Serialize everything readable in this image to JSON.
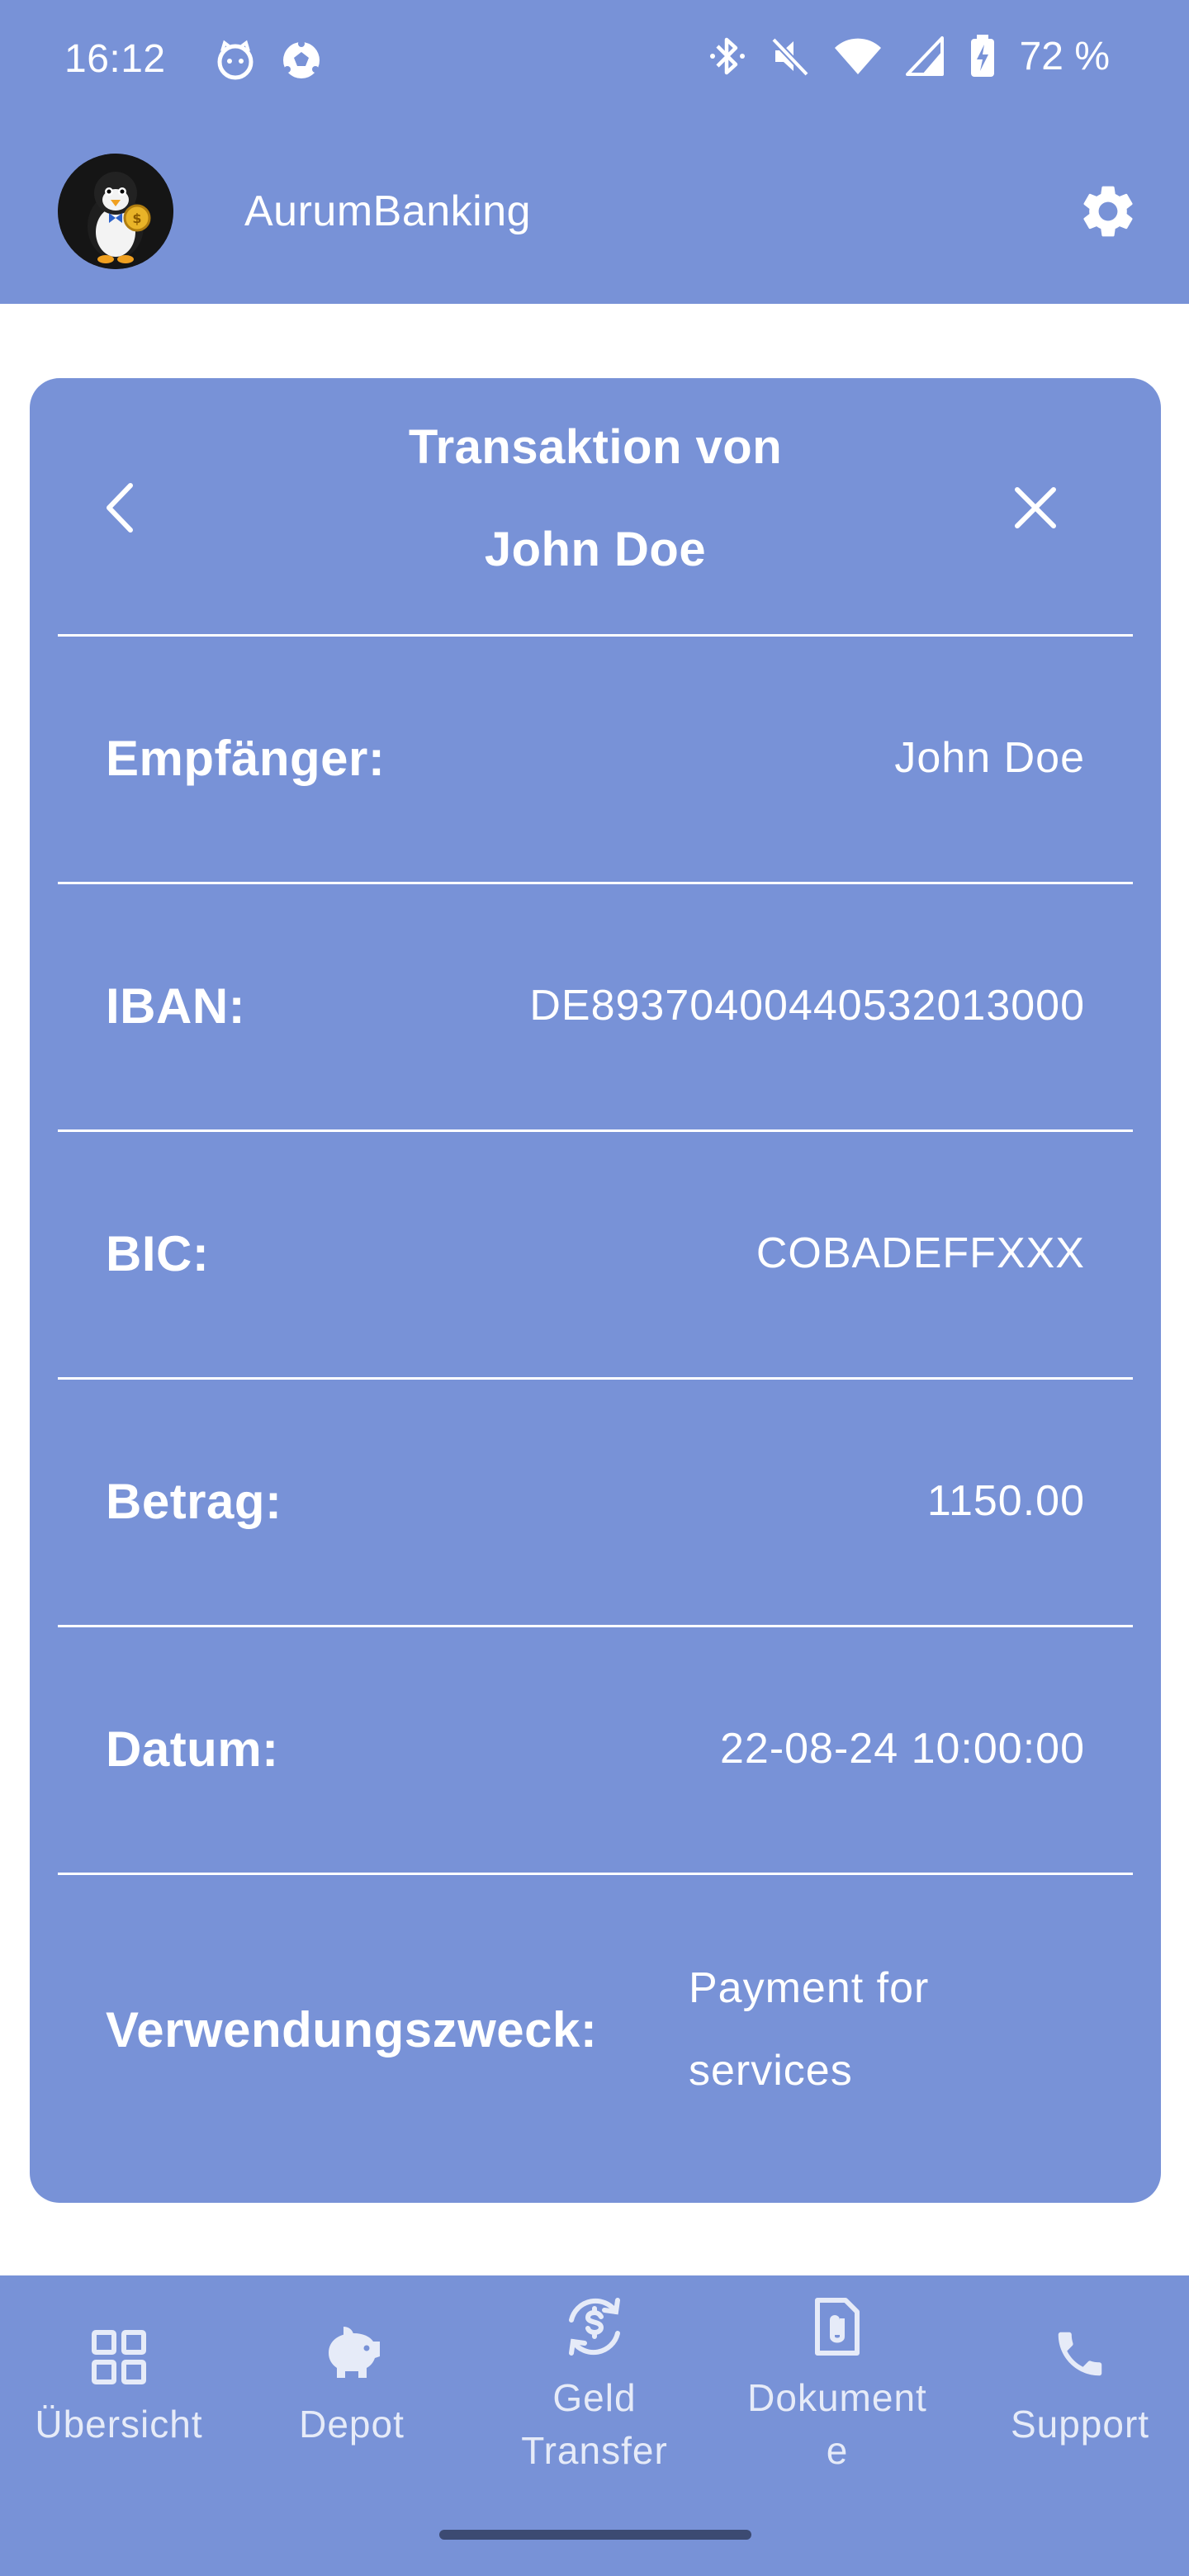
{
  "status_bar": {
    "time": "16:12",
    "battery": "72 %",
    "icons": [
      "cat-notification-icon",
      "soccer-ball-icon",
      "bluetooth-icon",
      "mute-icon",
      "wifi-icon",
      "cell-signal-icon",
      "battery-charging-icon"
    ]
  },
  "app_bar": {
    "title": "AurumBanking",
    "avatar": "penguin-logo-icon",
    "settings_icon": "gear-icon"
  },
  "card": {
    "title_line1": "Transaktion von",
    "title_line2": "John Doe",
    "back_icon": "chevron-left-icon",
    "close_icon": "close-icon",
    "rows": [
      {
        "label": "Empfänger:",
        "value": "John Doe"
      },
      {
        "label": "IBAN:",
        "value": "DE89370400440532013000"
      },
      {
        "label": "BIC:",
        "value": "COBADEFFXXX"
      },
      {
        "label": "Betrag:",
        "value": "1150.00"
      },
      {
        "label": "Datum:",
        "value": "22-08-24 10:00:00"
      },
      {
        "label": "Verwendungszweck:",
        "value_line1": "Payment for",
        "value_line2": "services"
      }
    ]
  },
  "bottom_nav": {
    "items": [
      {
        "label": "Übersicht",
        "icon": "grid-icon"
      },
      {
        "label": "Depot",
        "icon": "piggy-bank-icon"
      },
      {
        "label_line1": "Geld",
        "label_line2": "Transfer",
        "icon": "money-transfer-icon"
      },
      {
        "label_line1": "Dokument",
        "label_line2": "e",
        "icon": "document-icon"
      },
      {
        "label": "Support",
        "icon": "phone-icon"
      }
    ]
  },
  "colors": {
    "primary": "#7892d7",
    "background": "#ffffff",
    "text": "#ffffff"
  }
}
